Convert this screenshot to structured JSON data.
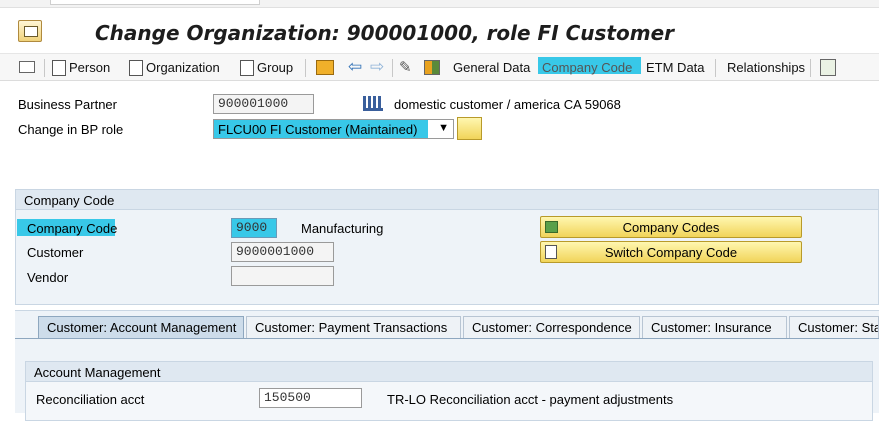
{
  "window": {
    "title": "Change Organization: 900001000, role FI Customer"
  },
  "toolbar": {
    "person": "Person",
    "organization": "Organization",
    "group": "Group",
    "general_data": "General Data",
    "company_code": "Company Code",
    "etm_data": "ETM Data",
    "relationships": "Relationships"
  },
  "header": {
    "bp_label": "Business Partner",
    "bp_value": "900001000",
    "bp_desc": "domestic customer / america CA 59068",
    "role_label": "Change in BP role",
    "role_value": "FLCU00 FI Customer (Maintained)"
  },
  "company_panel": {
    "title": "Company Code",
    "cc_label": "Company Code",
    "cc_value": "9000",
    "cc_desc": "Manufacturing",
    "customer_label": "Customer",
    "customer_value": "9000001000",
    "vendor_label": "Vendor",
    "vendor_value": "",
    "btn_company_codes": "Company Codes",
    "btn_switch": "Switch Company Code"
  },
  "tabs": [
    {
      "label": "Customer: Account Management"
    },
    {
      "label": "Customer: Payment Transactions"
    },
    {
      "label": "Customer: Correspondence"
    },
    {
      "label": "Customer: Insurance"
    },
    {
      "label": "Customer: Sta"
    }
  ],
  "account_panel": {
    "title": "Account Management",
    "recon_label": "Reconciliation acct",
    "recon_value": "150500",
    "recon_desc": "TR-LO Reconciliation acct - payment adjustments"
  },
  "colors": {
    "highlight": "#38c8e8",
    "button": "#f1d45a",
    "panel": "#eef3f8"
  }
}
